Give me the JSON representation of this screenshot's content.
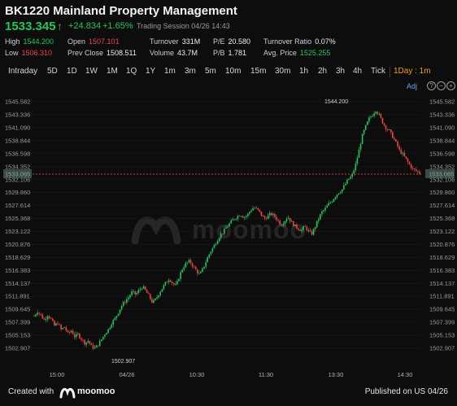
{
  "header": {
    "title": "BK1220 Mainland Property Management",
    "price": "1533.345",
    "change": "+24.834",
    "change_pct": "+1.65%",
    "session": "Trading Session 04/26 14:43"
  },
  "stats": [
    {
      "label": "High",
      "value": "1544.200",
      "color": "g"
    },
    {
      "label": "Open",
      "value": "1507.101",
      "color": "r"
    },
    {
      "label": "Turnover",
      "value": "331M",
      "color": "w"
    },
    {
      "label": "P/E",
      "value": "20.580",
      "color": "w"
    },
    {
      "label": "Turnover Ratio",
      "value": "0.07%",
      "color": "w"
    },
    {
      "label": "Low",
      "value": "1506.310",
      "color": "r"
    },
    {
      "label": "Prev Close",
      "value": "1508.511",
      "color": "w"
    },
    {
      "label": "Volume",
      "value": "43.7M",
      "color": "w"
    },
    {
      "label": "P/B",
      "value": "1.781",
      "color": "w"
    },
    {
      "label": "Avg. Price",
      "value": "1525.255",
      "color": "g"
    }
  ],
  "tabs": [
    "Intraday",
    "5D",
    "1D",
    "1W",
    "1M",
    "1Q",
    "1Y",
    "1m",
    "3m",
    "5m",
    "10m",
    "15m",
    "30m",
    "1h",
    "2h",
    "3h",
    "4h",
    "Tick",
    "1Day : 1m"
  ],
  "active_tab": "1Day : 1m",
  "adj_label": "Adj",
  "colors": {
    "up": "#22c55e",
    "down": "#ef4444",
    "bg": "#0d0d0d",
    "accent": "#f59e0b",
    "prev_close_line": "#ef4444"
  },
  "chart_data": {
    "type": "candlestick",
    "ylim": [
      1501.5,
      1546.3
    ],
    "y_ticks": [
      "1545.582",
      "1543.336",
      "1541.090",
      "1538.844",
      "1536.598",
      "1534.352",
      "1532.106",
      "1529.860",
      "1527.614",
      "1525.368",
      "1523.122",
      "1520.876",
      "1518.629",
      "1516.383",
      "1514.137",
      "1511.891",
      "1509.645",
      "1507.399",
      "1505.153",
      "1502.907"
    ],
    "x_ticks": [
      "15:00",
      "04/26",
      "10:30",
      "11:30",
      "13:30",
      "14:30"
    ],
    "prev_close_label": "1533.065",
    "prev_close_value": 1533.065,
    "high_label": "1544.200",
    "low_label": "1502.907",
    "path": [
      1508.5,
      1509.3,
      1508.6,
      1507.8,
      1508.7,
      1507.9,
      1506.8,
      1507.3,
      1506.1,
      1506.6,
      1505.4,
      1506.0,
      1504.9,
      1505.3,
      1504.5,
      1503.8,
      1504.2,
      1503.2,
      1502.9,
      1503.6,
      1504.5,
      1505.5,
      1506.2,
      1507.4,
      1508.1,
      1509.3,
      1510.4,
      1511.1,
      1511.8,
      1512.7,
      1512.2,
      1512.9,
      1513.6,
      1512.8,
      1511.9,
      1510.8,
      1511.4,
      1512.5,
      1513.4,
      1514.3,
      1515.0,
      1514.1,
      1513.7,
      1515.5,
      1516.9,
      1517.6,
      1518.0,
      1517.1,
      1516.3,
      1515.6,
      1516.8,
      1518.2,
      1519.5,
      1520.4,
      1521.5,
      1522.5,
      1523.1,
      1524.0,
      1524.6,
      1525.3,
      1525.7,
      1526.1,
      1525.6,
      1525.9,
      1526.8,
      1527.3,
      1526.9,
      1526.2,
      1525.3,
      1525.7,
      1526.2,
      1525.8,
      1525.1,
      1524.3,
      1524.9,
      1525.7,
      1524.8,
      1524.1,
      1523.7,
      1523.3,
      1524.0,
      1523.3,
      1522.6,
      1523.8,
      1525.2,
      1526.4,
      1527.0,
      1527.8,
      1528.4,
      1529.2,
      1529.9,
      1530.3,
      1531.3,
      1532.2,
      1532.8,
      1534.5,
      1537.0,
      1539.6,
      1541.2,
      1542.6,
      1543.3,
      1544.2,
      1543.3,
      1542.1,
      1541.1,
      1540.6,
      1539.6,
      1538.5,
      1537.2,
      1536.5,
      1535.6,
      1534.7,
      1533.9,
      1533.6,
      1533.3
    ]
  }
}
